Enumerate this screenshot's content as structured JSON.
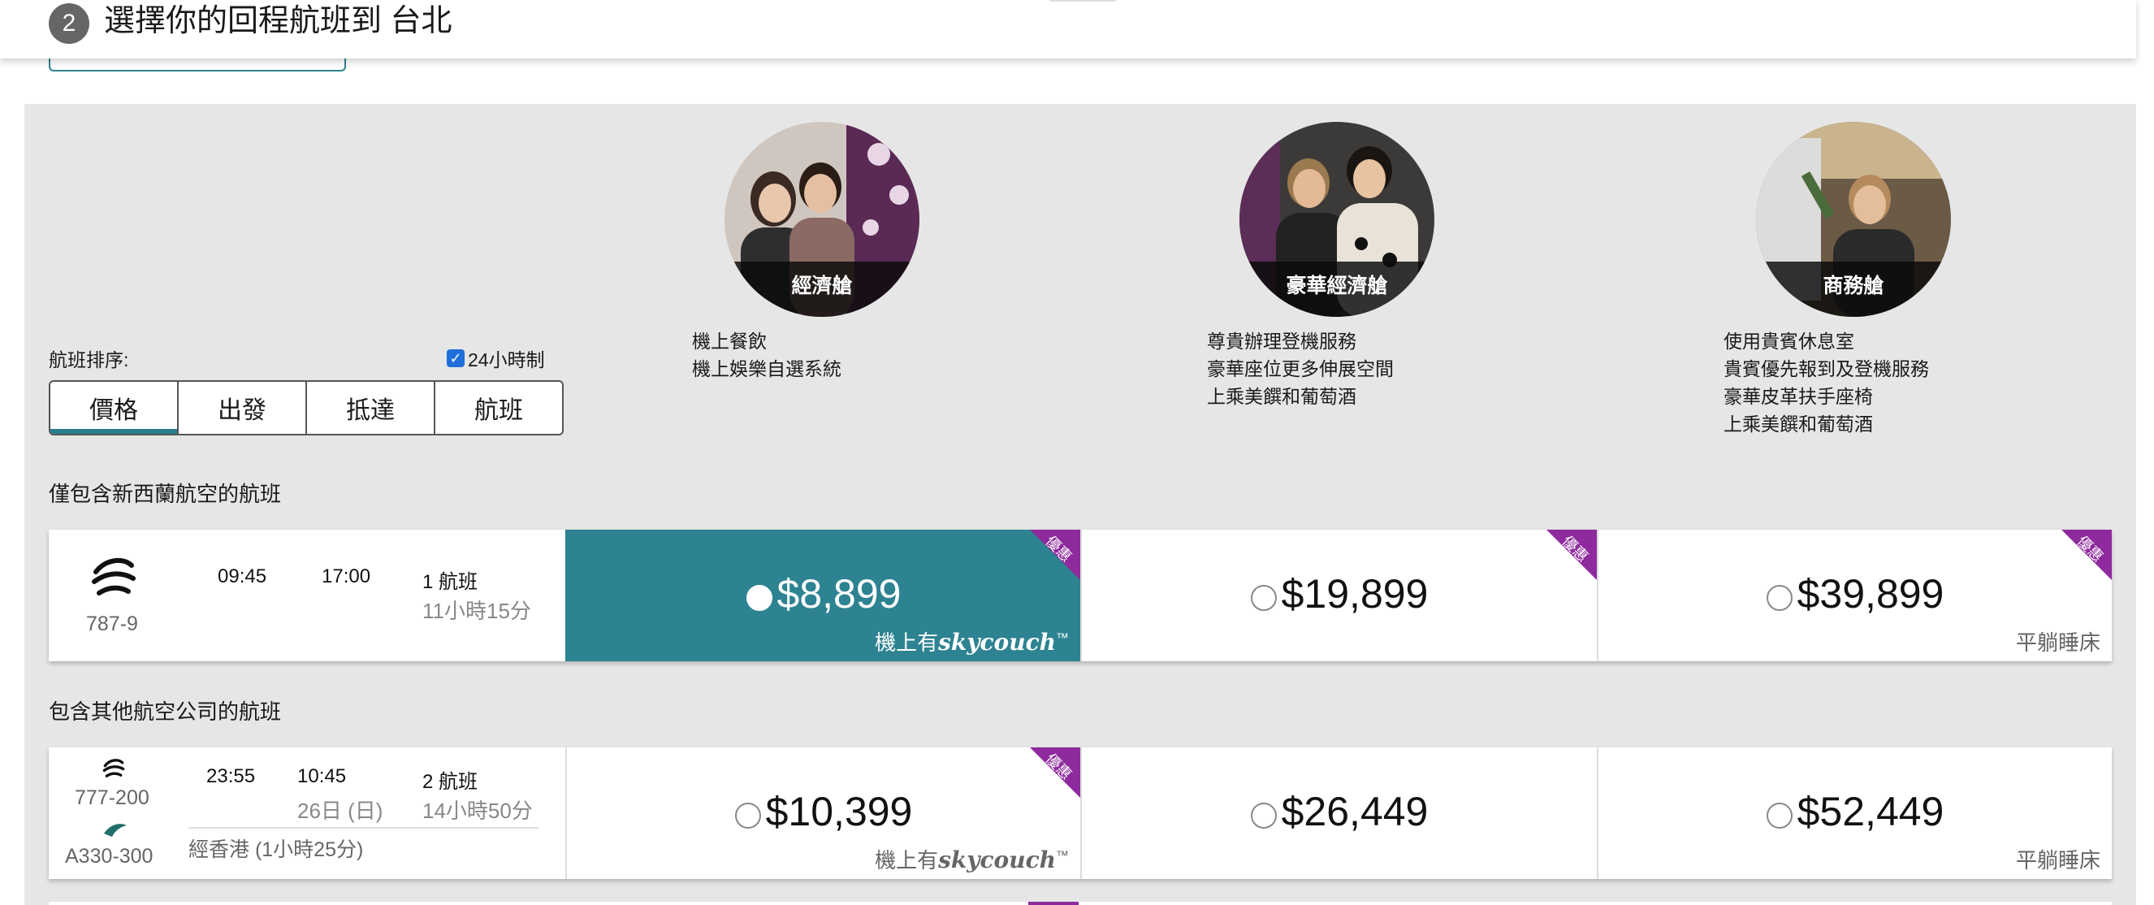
{
  "header": {
    "step": "2",
    "title": "選擇你的回程航班到 台北"
  },
  "cabins": [
    {
      "name": "經濟艙",
      "features": [
        "機上餐飲",
        "機上娛樂自選系統"
      ]
    },
    {
      "name": "豪華經濟艙",
      "features": [
        "尊貴辦理登機服務",
        "豪華座位更多伸展空間",
        "上乘美饌和葡萄酒"
      ]
    },
    {
      "name": "商務艙",
      "features": [
        "使用貴賓休息室",
        "貴賓優先報到及登機服務",
        "豪華皮革扶手座椅",
        "上乘美饌和葡萄酒"
      ]
    }
  ],
  "sort": {
    "label": "航班排序:",
    "clock24": "24小時制",
    "clock24_checked": true,
    "tabs": [
      "價格",
      "出發",
      "抵達",
      "航班"
    ],
    "active": "價格"
  },
  "sections": {
    "nz_only": "僅包含新西蘭航空的航班",
    "others": "包含其他航空公司的航班"
  },
  "flights": [
    {
      "aircraft": "787-9",
      "depart": "09:45",
      "arrive": "17:00",
      "flights_count": "1 航班",
      "duration": "11小時15分",
      "fares": [
        {
          "price": "$8,899",
          "note_prefix": "機上有",
          "note_brand": "skycouch",
          "note_tm": "™",
          "badge": "優惠",
          "selected": true
        },
        {
          "price": "$19,899",
          "badge": "優惠"
        },
        {
          "price": "$39,899",
          "note": "平躺睡床",
          "badge": "優惠"
        }
      ]
    },
    {
      "aircraft": "777-200",
      "aircraft2": "A330-300",
      "depart": "23:55",
      "arrive": "10:45",
      "arrive_date": "26日 (日)",
      "flights_count": "2 航班",
      "duration": "14小時50分",
      "via": "經香港 (1小時25分)",
      "fares": [
        {
          "price": "$10,399",
          "note_prefix": "機上有",
          "note_brand": "skycouch",
          "note_tm": "™",
          "badge": "優惠"
        },
        {
          "price": "$26,449"
        },
        {
          "price": "$52,449",
          "note": "平躺睡床"
        }
      ]
    }
  ]
}
